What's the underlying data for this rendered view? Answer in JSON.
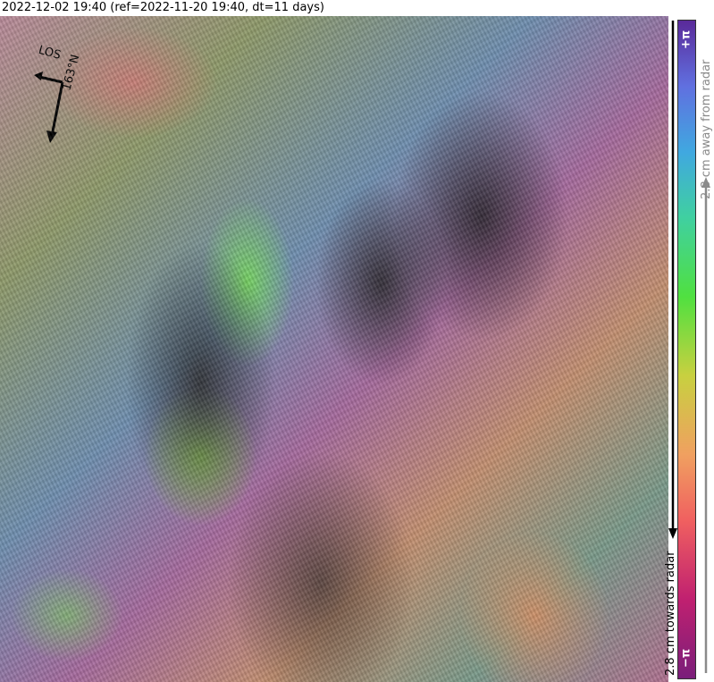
{
  "header": {
    "title": "2022-12-02 19:40 (ref=2022-11-20 19:40, dt=11 days)"
  },
  "compass": {
    "los_label": "LOS",
    "heading_label": "163°N"
  },
  "colorbar": {
    "top_label": "+π",
    "bottom_label": "−π",
    "away_label": "2.8 cm away from radar",
    "towards_label": "2.8 cm towards radar",
    "colors": [
      "#7a1e7a",
      "#c02070",
      "#f06060",
      "#f0a060",
      "#c8d040",
      "#50e040",
      "#40d0a0",
      "#40a8e0",
      "#6070e0",
      "#5a2a9a"
    ],
    "away_arrow_color": "#8a8a8a",
    "towards_arrow_color": "#000000"
  }
}
